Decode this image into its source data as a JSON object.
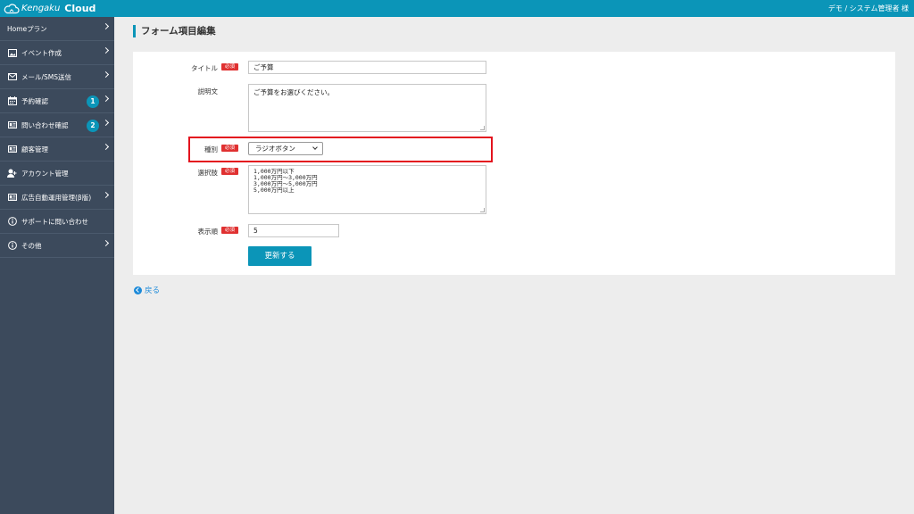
{
  "header": {
    "brand_a": "Kengaku",
    "brand_b": "Cloud",
    "user": "デモ / システム管理者 様"
  },
  "sidebar": {
    "items": [
      {
        "label": "Homeプラン",
        "icon": "",
        "badge": null
      },
      {
        "label": "イベント作成",
        "icon": "image-icon",
        "badge": null
      },
      {
        "label": "メール/SMS送信",
        "icon": "envelope-icon",
        "badge": null
      },
      {
        "label": "予約確認",
        "icon": "calendar-icon",
        "badge": "1"
      },
      {
        "label": "問い合わせ確認",
        "icon": "id-card-icon",
        "badge": "2"
      },
      {
        "label": "顧客管理",
        "icon": "id-card-icon",
        "badge": null
      },
      {
        "label": "アカウント管理",
        "icon": "user-icon",
        "badge": null
      },
      {
        "label": "広告自動運用管理(β版)",
        "icon": "id-card-icon",
        "badge": null
      },
      {
        "label": "サポートに問い合わせ",
        "icon": "info-icon",
        "badge": null
      },
      {
        "label": "その他",
        "icon": "info-icon",
        "badge": null
      }
    ]
  },
  "page": {
    "title": "フォーム項目編集",
    "required_label": "必須"
  },
  "form": {
    "title_label": "タイトル",
    "title_value": "ご予算",
    "description_label": "説明文",
    "description_value": "ご予算をお選びください。",
    "type_label": "種別",
    "type_value": "ラジオボタン",
    "choices_label": "選択肢",
    "choices": [
      "1,000万円以下",
      "1,000万円～3,000万円",
      "3,000万円～5,000万円",
      "5,000万円以上"
    ],
    "order_label": "表示順",
    "order_value": "5",
    "submit_label": "更新する"
  },
  "footer": {
    "back_label": "戻る"
  },
  "colors": {
    "accent": "#0b95b8",
    "sidebar": "#3c4a5c",
    "required": "#e03131",
    "highlight": "#e3131e",
    "link": "#1c8ad9"
  }
}
